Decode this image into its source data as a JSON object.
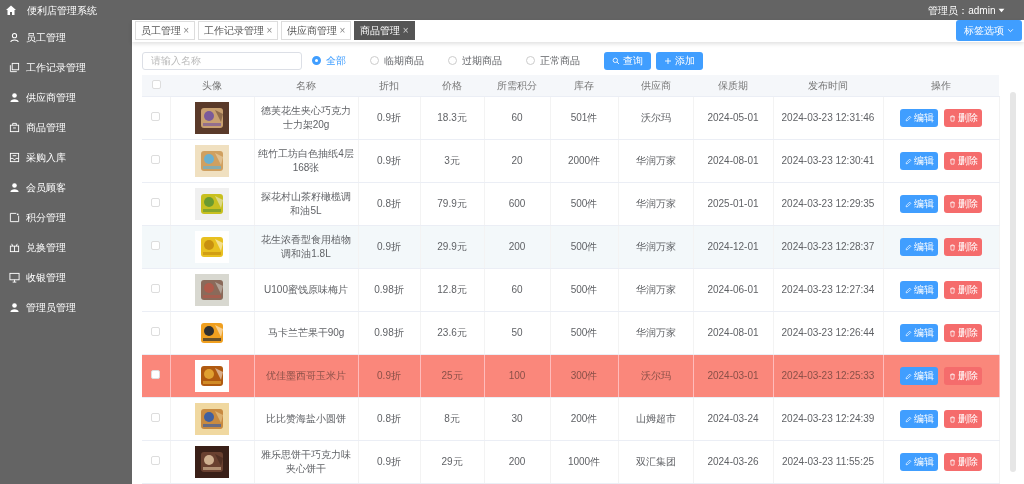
{
  "app": {
    "title": "便利店管理系统",
    "user": "管理员：admin"
  },
  "sidebar": {
    "items": [
      {
        "label": "员工管理",
        "selected": false
      },
      {
        "label": "工作记录管理",
        "selected": false
      },
      {
        "label": "供应商管理",
        "selected": false
      },
      {
        "label": "商品管理",
        "selected": false
      },
      {
        "label": "采购入库",
        "selected": false
      },
      {
        "label": "会员顾客",
        "selected": false
      },
      {
        "label": "积分管理",
        "selected": false
      },
      {
        "label": "兑换管理",
        "selected": false
      },
      {
        "label": "收银管理",
        "selected": false
      },
      {
        "label": "管理员管理",
        "selected": false
      }
    ]
  },
  "tabs": [
    {
      "label": "员工管理",
      "close": "×",
      "selected": false
    },
    {
      "label": "工作记录管理",
      "close": "×",
      "selected": false
    },
    {
      "label": "供应商管理",
      "close": "×",
      "selected": false
    },
    {
      "label": "商品管理",
      "close": "×",
      "selected": true
    }
  ],
  "tab_options": {
    "label": "标签选项"
  },
  "search": {
    "placeholder": "请输入名称"
  },
  "filters": [
    {
      "label": "全部",
      "selected": true
    },
    {
      "label": "临期商品",
      "selected": false
    },
    {
      "label": "过期商品",
      "selected": false
    },
    {
      "label": "正常商品",
      "selected": false
    }
  ],
  "buttons": [
    {
      "label": "查询",
      "kind": "search"
    },
    {
      "label": "添加",
      "kind": "add"
    }
  ],
  "table": {
    "columns": [
      "头像",
      "名称",
      "折扣",
      "价格",
      "所需积分",
      "库存",
      "供应商",
      "保质期",
      "发布时间",
      "操作"
    ],
    "select_all": {
      "checked": false
    },
    "rows": [
      {
        "name": "德芙花生夹心巧克力士力架20g",
        "discount": "0.9折",
        "price": "18.3元",
        "points": "60",
        "stock": "501件",
        "supplier": "沃尔玛",
        "shelf_life": "2024-05-01",
        "published": "2024-03-23 12:31:46",
        "checked": false,
        "hovered": false,
        "expired": false,
        "actions": [
          "编辑",
          "删除"
        ]
      },
      {
        "name": "纯竹工坊白色抽纸4层168张",
        "discount": "0.9折",
        "price": "3元",
        "points": "20",
        "stock": "2000件",
        "supplier": "华润万家",
        "shelf_life": "2024-08-01",
        "published": "2024-03-23 12:30:41",
        "checked": false,
        "hovered": false,
        "expired": false,
        "actions": [
          "编辑",
          "删除"
        ]
      },
      {
        "name": "探花村山茶籽橄榄调和油5L",
        "discount": "0.8折",
        "price": "79.9元",
        "points": "600",
        "stock": "500件",
        "supplier": "华润万家",
        "shelf_life": "2025-01-01",
        "published": "2024-03-23 12:29:35",
        "checked": false,
        "hovered": false,
        "expired": false,
        "actions": [
          "编辑",
          "删除"
        ]
      },
      {
        "name": "花生浓香型食用植物调和油1.8L",
        "discount": "0.9折",
        "price": "29.9元",
        "points": "200",
        "stock": "500件",
        "supplier": "华润万家",
        "shelf_life": "2024-12-01",
        "published": "2024-03-23 12:28:37",
        "checked": false,
        "hovered": true,
        "expired": false,
        "actions": [
          "编辑",
          "删除"
        ]
      },
      {
        "name": "U100蜜饯原味梅片",
        "discount": "0.98折",
        "price": "12.8元",
        "points": "60",
        "stock": "500件",
        "supplier": "华润万家",
        "shelf_life": "2024-06-01",
        "published": "2024-03-23 12:27:34",
        "checked": false,
        "hovered": false,
        "expired": false,
        "actions": [
          "编辑",
          "删除"
        ]
      },
      {
        "name": "马卡兰芒果干90g",
        "discount": "0.98折",
        "price": "23.6元",
        "points": "50",
        "stock": "500件",
        "supplier": "华润万家",
        "shelf_life": "2024-08-01",
        "published": "2024-03-23 12:26:44",
        "checked": false,
        "hovered": false,
        "expired": false,
        "actions": [
          "编辑",
          "删除"
        ]
      },
      {
        "name": "优佳墨西哥玉米片",
        "discount": "0.9折",
        "price": "25元",
        "points": "100",
        "stock": "300件",
        "supplier": "沃尔玛",
        "shelf_life": "2024-03-01",
        "published": "2024-03-23 12:25:33",
        "checked": false,
        "hovered": false,
        "expired": true,
        "actions": [
          "编辑",
          "删除"
        ]
      },
      {
        "name": "比比赞海盐小圆饼",
        "discount": "0.8折",
        "price": "8元",
        "points": "30",
        "stock": "200件",
        "supplier": "山姆超市",
        "shelf_life": "2024-03-24",
        "published": "2024-03-23 12:24:39",
        "checked": false,
        "hovered": false,
        "expired": false,
        "actions": [
          "编辑",
          "删除"
        ]
      },
      {
        "name": "雅乐思饼干巧克力味夹心饼干",
        "discount": "0.9折",
        "price": "29元",
        "points": "200",
        "stock": "1000件",
        "supplier": "双汇集团",
        "shelf_life": "2024-03-26",
        "published": "2024-03-23 11:55:25",
        "checked": false,
        "hovered": false,
        "expired": false,
        "actions": [
          "编辑",
          "删除"
        ]
      }
    ]
  }
}
